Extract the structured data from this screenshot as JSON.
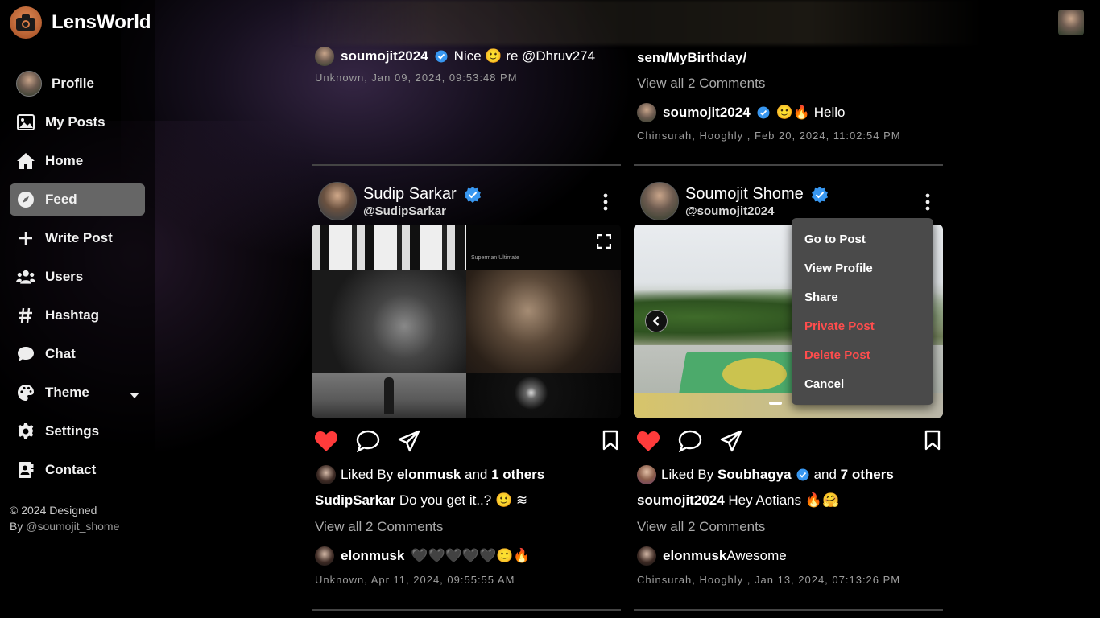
{
  "brand": {
    "name": "LensWorld"
  },
  "sidebar": {
    "items": [
      {
        "label": "Profile",
        "icon": "avatar"
      },
      {
        "label": "My Posts",
        "icon": "image-icon"
      },
      {
        "label": "Home",
        "icon": "home-icon"
      },
      {
        "label": "Feed",
        "icon": "compass-icon",
        "active": true
      },
      {
        "label": "Write Post",
        "icon": "plus-icon"
      },
      {
        "label": "Users",
        "icon": "users-icon"
      },
      {
        "label": "Hashtag",
        "icon": "hashtag-icon"
      },
      {
        "label": "Chat",
        "icon": "chat-icon"
      },
      {
        "label": "Theme",
        "icon": "palette-icon"
      },
      {
        "label": "Settings",
        "icon": "gear-icon"
      },
      {
        "label": "Contact",
        "icon": "contact-icon"
      }
    ],
    "copyright_line1": "© 2024 Designed",
    "copyright_by": "By ",
    "copyright_handle": "@soumojit_shome"
  },
  "top_left_post": {
    "comment_user": "soumojit2024",
    "comment_text": "Nice 🙂 re @Dhruv274",
    "meta": "Unknown, Jan 09, 2024, 09:53:48 PM"
  },
  "top_right_post": {
    "caption_tail": "sem/MyBirthday/",
    "view_all": "View all 2 Comments",
    "comment_user": "soumojit2024",
    "comment_text": "🙂🔥 Hello",
    "meta": "Chinsurah, Hooghly , Feb 20, 2024, 11:02:54 PM"
  },
  "post_left": {
    "name": "Sudip Sarkar",
    "username": "@SudipSarkar",
    "liked_by_prefix": "Liked By ",
    "liked_by_user": "elonmusk",
    "liked_by_and": " and ",
    "liked_by_others": "1 others",
    "caption_user": "SudipSarkar",
    "caption_text": " Do you get it..? 🙂 ≋",
    "view_all": "View all 2 Comments",
    "comment_user": "elonmusk",
    "comment_text": "🖤🖤🖤🖤🖤🙂🔥",
    "meta": "Unknown, Apr 11, 2024, 09:55:55 AM",
    "image_label": "Superman Ultimate"
  },
  "post_right": {
    "name": "Soumojit Shome",
    "username": "@soumojit2024",
    "liked_by_prefix": "Liked By ",
    "liked_by_user": "Soubhagya",
    "liked_by_and": " and ",
    "liked_by_others": "7 others",
    "caption_user": "soumojit2024",
    "caption_text": " Hey Aotians 🔥🤗",
    "view_all": "View all 2 Comments",
    "comment_user": "elonmusk",
    "comment_text": " Awesome",
    "meta": "Chinsurah, Hooghly , Jan 13, 2024, 07:13:26 PM"
  },
  "post_menu": {
    "items": [
      {
        "label": "Go to Post",
        "danger": false
      },
      {
        "label": "View Profile",
        "danger": false
      },
      {
        "label": "Share",
        "danger": false
      },
      {
        "label": "Private Post",
        "danger": true
      },
      {
        "label": "Delete Post",
        "danger": true
      },
      {
        "label": "Cancel",
        "danger": false
      }
    ]
  },
  "colors": {
    "like": "#ff3b3b",
    "danger": "#ff4d4d",
    "active_nav": "#666666",
    "verified": "#3897f0"
  }
}
